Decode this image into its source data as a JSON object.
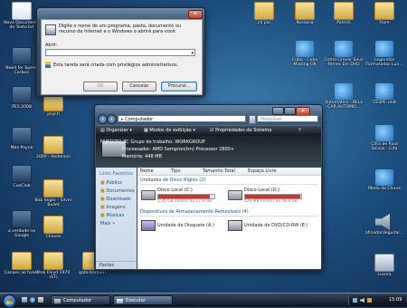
{
  "desktop": {
    "icons": [
      {
        "label": "Novo Documento de Texto.txt"
      },
      {
        "label": "Need for Speed Carbon"
      },
      {
        "label": "PES 2008"
      },
      {
        "label": "Max Payne"
      },
      {
        "label": "CueClub"
      },
      {
        "label": "a verdade no Google"
      },
      {
        "label": "Canaes ao fundo"
      },
      {
        "label": "psych"
      },
      {
        "label": "2000 - Anderson"
      },
      {
        "label": "Bob Seger - Silver Bullet"
      },
      {
        "label": "Chaves"
      },
      {
        "label": "Pink Floyd 1970 (ST)"
      },
      {
        "label": "gato-barbieri"
      },
      {
        "label": "cd pai"
      },
      {
        "label": "Rossana"
      },
      {
        "label": "Patrick"
      },
      {
        "label": "Flore"
      },
      {
        "label": "Cubo - Cubo Missing OK"
      },
      {
        "label": "Como Gravar Seus Filmes Em DVD"
      },
      {
        "label": "Legendas Formatadas Lua..."
      },
      {
        "label": "Automático - BELL CAR AUTOMO..."
      },
      {
        "label": "CESPE-UnB"
      },
      {
        "label": "Cifra de Raul Seixas - Gita"
      },
      {
        "label": "Medo da Chuva"
      },
      {
        "label": "afinadordeguitar..."
      },
      {
        "label": "Lixeira"
      }
    ]
  },
  "run_dialog": {
    "description": "Digite o nome de um programa, pasta, documento ou recurso da Internet e o Windows o abrirá para você.",
    "open_label": "Abrir:",
    "open_value": "",
    "admin_note": "Esta tarefa será criada com privilégios administrativos.",
    "ok_label": "OK",
    "cancel_label": "Cancelar",
    "browse_label": "Procurar..."
  },
  "explorer": {
    "address": "Computador",
    "search_placeholder": "Pesquisar",
    "toolbar": {
      "organize": "Organizar",
      "views": "Modos de exibição",
      "system_properties": "Propriedades do Sistema"
    },
    "details": {
      "line1": "FABI0250-PC  Grupo de trabalho: WORKGROUP",
      "line2": "Processador: AMD Sempron(tm) Processor 2800+",
      "line3": "Memória: 448 MB"
    },
    "favorites_title": "Links Favoritos",
    "favorites": [
      "Público",
      "Documentos",
      "Downloads",
      "Imagens",
      "Músicas"
    ],
    "more_label": "Mais",
    "folders_label": "Pastas",
    "columns": [
      "Nome",
      "Tipo",
      "Tamanho Total",
      "Espaço Livre"
    ],
    "hdd_group": "Unidades de Disco Rígido (2)",
    "drives": [
      {
        "name": "Disco Local (C:)",
        "info": "1,35 GB livre(s) de 17,9 GB",
        "fill": 0.92
      },
      {
        "name": "Disco Local (D:)",
        "info": "426 MB livre(s) de 56,9 GB",
        "fill": 0.99
      }
    ],
    "removable_group": "Dispositivos de Armazenamento Removíveis (4)",
    "removable": [
      {
        "name": "Unidade de Disquete (A:)"
      },
      {
        "name": "Unidade de DVD/CD-RW (E:)"
      }
    ]
  },
  "taskbar": {
    "buttons": [
      "Computador",
      "Executar"
    ],
    "clock": "15:09"
  },
  "colors": {
    "drive_bar": "#d2322d"
  }
}
